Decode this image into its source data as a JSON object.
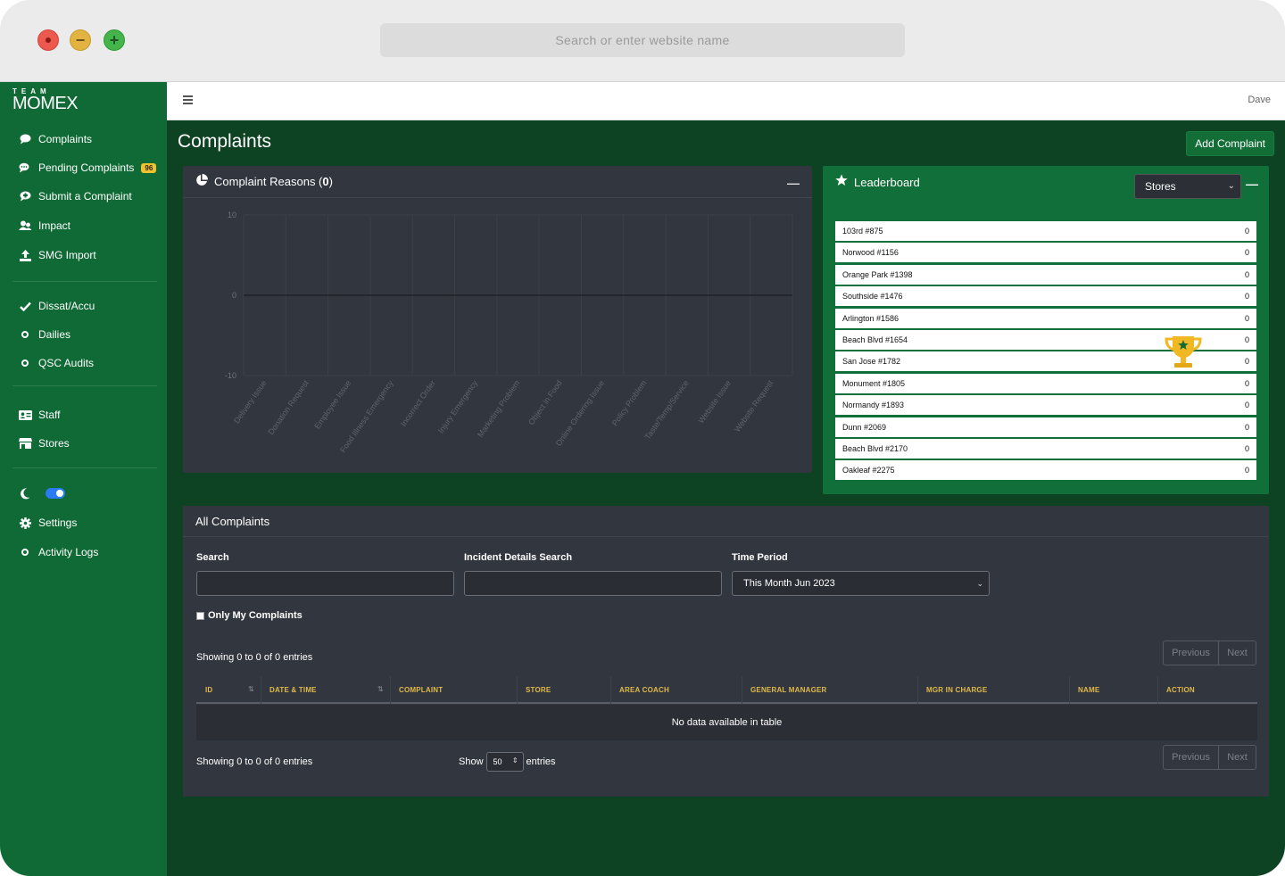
{
  "browser": {
    "address_placeholder": "Search or enter website name"
  },
  "brand": {
    "top": "TEAM",
    "name": "MOMEX"
  },
  "sidebar": {
    "items": [
      {
        "label": "Complaints",
        "icon": "comment-icon"
      },
      {
        "label": "Pending Complaints",
        "icon": "comments-icon",
        "badge": "96"
      },
      {
        "label": "Submit a Complaint",
        "icon": "comment-dots-icon"
      },
      {
        "label": "Impact",
        "icon": "people-icon"
      },
      {
        "label": "SMG Import",
        "icon": "upload-icon"
      },
      {
        "label": "Dissat/Accu",
        "icon": "check-icon"
      },
      {
        "label": "Dailies",
        "icon": "circle-icon"
      },
      {
        "label": "QSC Audits",
        "icon": "circle-icon"
      },
      {
        "label": "Staff",
        "icon": "id-card-icon"
      },
      {
        "label": "Stores",
        "icon": "store-icon"
      },
      {
        "label": "Settings",
        "icon": "gear-icon"
      },
      {
        "label": "Activity Logs",
        "icon": "circle-icon"
      }
    ]
  },
  "topbar": {
    "user": "Dave"
  },
  "page": {
    "title": "Complaints",
    "add_button": "Add Complaint"
  },
  "chart_panel": {
    "title_prefix": "Complaint Reasons (",
    "count": "0",
    "title_suffix": ")"
  },
  "chart_data": {
    "type": "bar",
    "title": "Complaint Reasons (0)",
    "categories": [
      "Delivery Issue",
      "Donation Request",
      "Employee Issue",
      "Food Illness Emergency",
      "Incorrect Order",
      "Injury Emergency",
      "Marketing Problem",
      "Object in Food",
      "Online Ordering Issue",
      "Policy Problem",
      "Taste/Temp/Service",
      "Website Issue",
      "Website Request"
    ],
    "values": [
      0,
      0,
      0,
      0,
      0,
      0,
      0,
      0,
      0,
      0,
      0,
      0,
      0
    ],
    "yticks": [
      "10",
      "0",
      "-10"
    ],
    "ylim": [
      -10,
      10
    ],
    "grid": true
  },
  "leaderboard": {
    "title": "Leaderboard",
    "select_value": "Stores",
    "rows": [
      {
        "name": "103rd #875",
        "value": "0"
      },
      {
        "name": "Norwood #1156",
        "value": "0"
      },
      {
        "name": "Orange Park #1398",
        "value": "0"
      },
      {
        "name": "Southside #1476",
        "value": "0"
      },
      {
        "name": "Arlington #1586",
        "value": "0"
      },
      {
        "name": "Beach Blvd #1654",
        "value": "0"
      },
      {
        "name": "San Jose #1782",
        "value": "0"
      },
      {
        "name": "Monument #1805",
        "value": "0"
      },
      {
        "name": "Normandy #1893",
        "value": "0"
      },
      {
        "name": "Dunn #2069",
        "value": "0"
      },
      {
        "name": "Beach Blvd #2170",
        "value": "0"
      },
      {
        "name": "Oakleaf #2275",
        "value": "0"
      }
    ]
  },
  "all_complaints": {
    "title": "All Complaints",
    "search_label": "Search",
    "incident_label": "Incident Details Search",
    "period_label": "Time Period",
    "period_value": "This Month Jun 2023",
    "only_mine": "Only My Complaints",
    "showing": "Showing 0 to 0 of 0 entries",
    "previous": "Previous",
    "next": "Next",
    "columns": [
      "ID",
      "DATE & TIME",
      "COMPLAINT",
      "STORE",
      "AREA COACH",
      "GENERAL MANAGER",
      "MGR IN CHARGE",
      "NAME",
      "ACTION"
    ],
    "empty": "No data available in table",
    "show_label": "Show",
    "show_value": "50",
    "entries_label": "entries"
  },
  "colors": {
    "sidebar": "#0f6a35",
    "main_bg": "#0d4322",
    "panel": "#32363e",
    "accent_gold": "#e0b84a",
    "badge": "#f2c12e"
  }
}
